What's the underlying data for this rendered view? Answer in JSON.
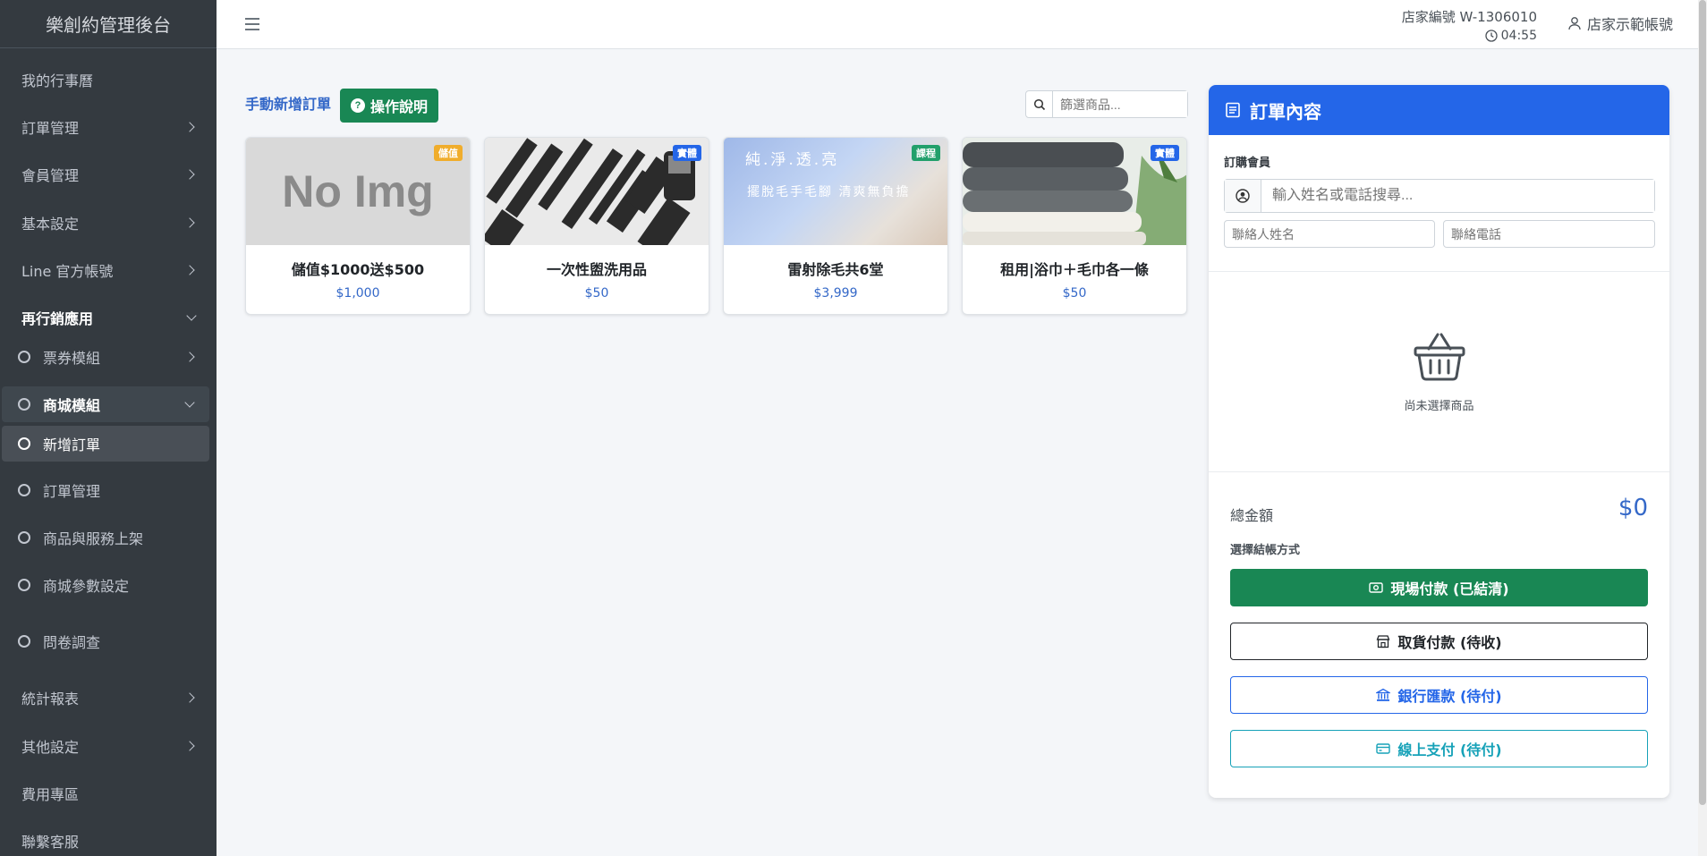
{
  "brand": "樂創約管理後台",
  "sidebar": {
    "items": [
      {
        "label": "我的行事曆"
      },
      {
        "label": "訂單管理"
      },
      {
        "label": "會員管理"
      },
      {
        "label": "基本設定"
      },
      {
        "label": "Line 官方帳號"
      },
      {
        "label": "再行銷應用"
      },
      {
        "label": "票券模組"
      },
      {
        "label": "商城模組"
      },
      {
        "label": "新增訂單"
      },
      {
        "label": "訂單管理"
      },
      {
        "label": "商品與服務上架"
      },
      {
        "label": "商城參數設定"
      },
      {
        "label": "問卷調查"
      },
      {
        "label": "統計報表"
      },
      {
        "label": "其他設定"
      },
      {
        "label": "費用專區"
      },
      {
        "label": "聯繫客服"
      }
    ]
  },
  "header": {
    "store_no": "店家編號 W-1306010",
    "time": "04:55",
    "user": "店家示範帳號"
  },
  "main": {
    "title": "手動新增訂單",
    "help_label": "操作說明",
    "filter_placeholder": "篩選商品...",
    "products": [
      {
        "name": "儲值$1000送$500",
        "price": "$1,000",
        "badge": "儲值",
        "badge_color": "#f0ad2c",
        "img_text": "No Img"
      },
      {
        "name": "一次性盥洗用品",
        "price": "$50",
        "badge": "實體",
        "badge_color": "#2466e8"
      },
      {
        "name": "雷射除毛共6堂",
        "price": "$3,999",
        "badge": "課程",
        "badge_color": "#22a06b",
        "img_text_1": "純.淨.透.亮",
        "img_text_2": "擺脫毛手毛腳 清爽無負擔"
      },
      {
        "name": "租用|浴巾＋毛巾各一條",
        "price": "$50",
        "badge": "實體",
        "badge_color": "#2466e8"
      }
    ]
  },
  "order": {
    "title": "訂單內容",
    "member_label": "訂購會員",
    "member_placeholder": "輸入姓名或電話搜尋...",
    "contact_name_placeholder": "聯絡人姓名",
    "contact_phone_placeholder": "聯絡電話",
    "empty_text": "尚未選擇商品",
    "total_label": "總金額",
    "total_value": "$0",
    "payment_label": "選擇結帳方式",
    "payments": [
      {
        "label": "現場付款 (已結清)"
      },
      {
        "label": "取貨付款 (待收)"
      },
      {
        "label": "銀行匯款 (待付)"
      },
      {
        "label": "線上支付 (待付)"
      }
    ]
  },
  "colors": {
    "sidebar_bg": "#343a40",
    "accent_blue": "#2466e8",
    "success_green": "#198754",
    "link_blue": "#3468c8",
    "info_cyan": "#17a2b8"
  }
}
